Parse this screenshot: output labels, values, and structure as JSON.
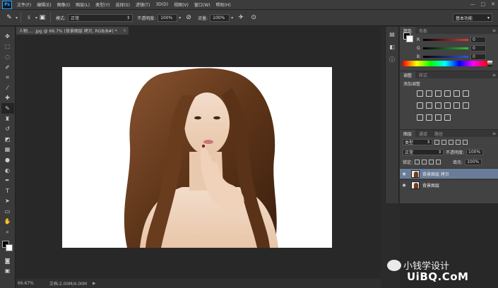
{
  "app": {
    "logo": "Ps"
  },
  "menu": [
    "文件(F)",
    "编辑(E)",
    "图像(I)",
    "图层(L)",
    "类型(Y)",
    "选择(S)",
    "滤镜(T)",
    "3D(D)",
    "视图(V)",
    "窗口(W)",
    "帮助(H)"
  ],
  "window_controls": {
    "minimize": "—",
    "maximize": "□",
    "close": "✕"
  },
  "options": {
    "brush_size": "5",
    "mode_label": "模式:",
    "mode_value": "正常",
    "opacity_label": "不透明度:",
    "opacity_value": "100%",
    "flow_label": "流量:",
    "flow_value": "100%",
    "workspace": "基本功能"
  },
  "document": {
    "tab_title": "人物.... .jpg @ 66.7% (背景图层 拷贝, RGB/8#) *",
    "tab_close": "×",
    "zoom": "66.67%",
    "doc_size": "文档:2.00M/4.00M",
    "status_arrow": "▶"
  },
  "panels": {
    "color": {
      "tabs": [
        "颜色",
        "色板"
      ],
      "sliders": [
        {
          "label": "R",
          "value": "0",
          "color": "#e03a3a"
        },
        {
          "label": "G",
          "value": "0",
          "color": "#2fc23a"
        },
        {
          "label": "B",
          "value": "0",
          "color": "#2f55e0"
        }
      ]
    },
    "adjustments": {
      "tabs": [
        "调整",
        "样式"
      ],
      "title": "添加调整"
    },
    "layers": {
      "tabs": [
        "图层",
        "通道",
        "路径"
      ],
      "filter_kind": "类型",
      "blend_mode": "正常",
      "opacity_label": "不透明度:",
      "opacity_value": "100%",
      "lock_label": "锁定:",
      "fill_label": "填充:",
      "fill_value": "100%",
      "items": [
        {
          "name": "背景图层 拷贝",
          "selected": true
        },
        {
          "name": "背景图层",
          "selected": false
        }
      ]
    }
  },
  "watermark": {
    "text": "小钱学设计",
    "site": "UiBQ.CoM"
  }
}
